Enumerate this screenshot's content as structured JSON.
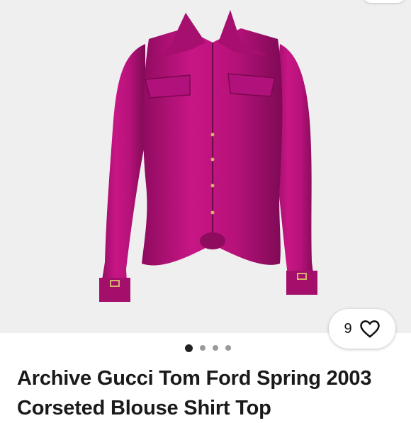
{
  "listing": {
    "title": "Archive Gucci Tom Ford Spring 2003 Corseted Blouse Shirt Top",
    "watch_count": "9",
    "image_count": 4,
    "active_image_index": 0
  },
  "icons": {
    "watch": "heart-outline-icon"
  },
  "colors": {
    "image_background": "#efefef",
    "product_color": "#c0147f",
    "text": "#1a1a1a"
  }
}
